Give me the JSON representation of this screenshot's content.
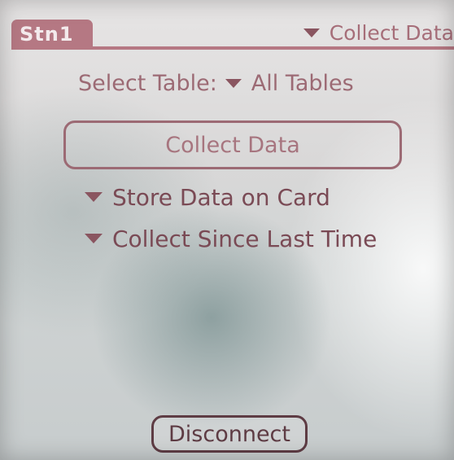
{
  "app": {
    "form_tab_title": "Stn1",
    "menu_trigger_label": "Collect Data"
  },
  "select_table": {
    "label": "Select Table:",
    "value": "All Tables"
  },
  "buttons": {
    "collect_data_label": "Collect Data",
    "disconnect_label": "Disconnect"
  },
  "options": {
    "store_data": "Store Data on Card",
    "collect_since": "Collect Since Last Time"
  },
  "colors": {
    "accent": "#b57883",
    "text": "#8a5560",
    "button_border": "#9c6a74"
  }
}
